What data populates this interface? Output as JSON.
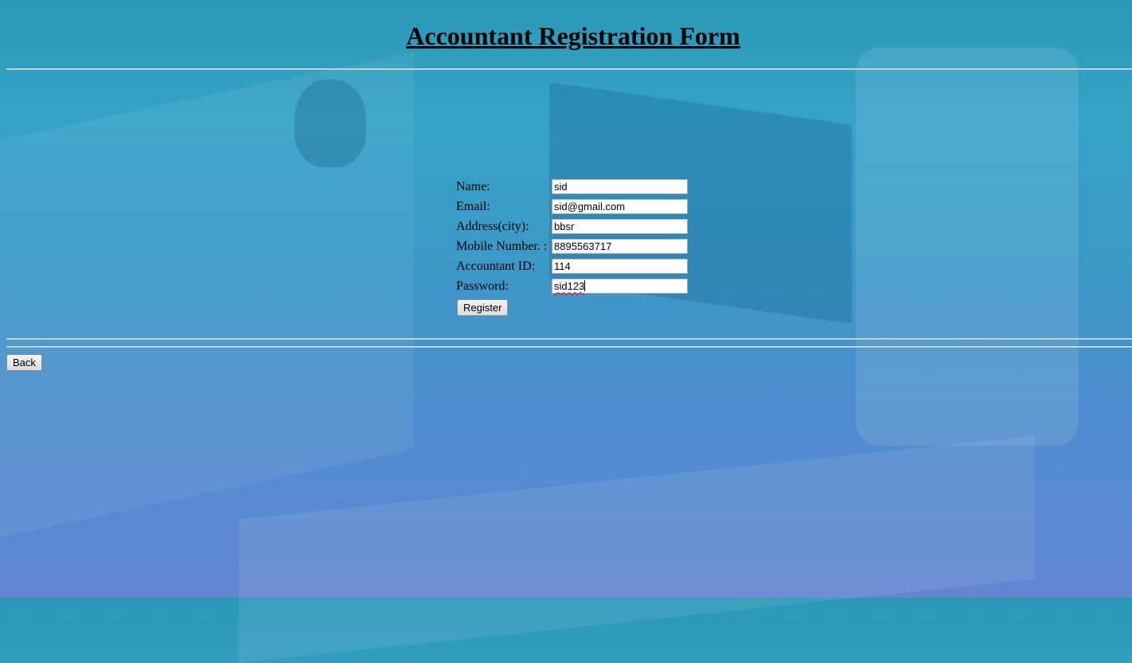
{
  "page": {
    "title": "Accountant Registration Form"
  },
  "form": {
    "fields": [
      {
        "label": "Name:",
        "value": "sid"
      },
      {
        "label": "Email:",
        "value": "sid@gmail.com"
      },
      {
        "label": "Address(city):",
        "value": "bbsr"
      },
      {
        "label": "Mobile Number. :",
        "value": "8895563717"
      },
      {
        "label": "Accountant ID:",
        "value": "114"
      },
      {
        "label": "Password:",
        "value": "sid123"
      }
    ],
    "register_label": "Register"
  },
  "nav": {
    "back_label": "Back"
  }
}
